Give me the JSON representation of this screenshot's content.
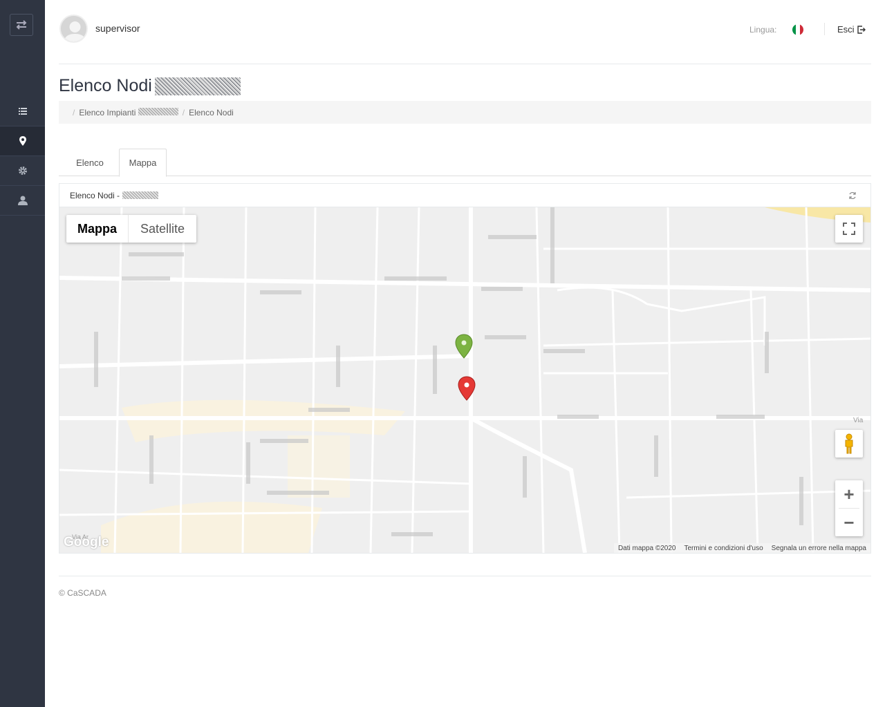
{
  "header": {
    "username": "supervisor",
    "language_label": "Lingua:",
    "logout_label": "Esci"
  },
  "page": {
    "title": "Elenco Nodi",
    "breadcrumb": {
      "item1": "Elenco Impianti",
      "item2": "Elenco Nodi"
    }
  },
  "tabs": [
    {
      "label": "Elenco",
      "active": false
    },
    {
      "label": "Mappa",
      "active": true
    }
  ],
  "panel": {
    "title": "Elenco Nodi -"
  },
  "map": {
    "type_buttons": {
      "map": "Mappa",
      "satellite": "Satellite"
    },
    "selected_type": "Mappa",
    "logo": "Google",
    "attribution": {
      "data": "Dati mappa ©2020",
      "terms": "Termini e condizioni d'uso",
      "report": "Segnala un errore nella mappa"
    },
    "markers": [
      {
        "color": "#7cb342",
        "name": "green-marker"
      },
      {
        "color": "#e53935",
        "name": "red-marker"
      }
    ],
    "street_labels": {
      "label1": "Via",
      "label2": "Via Ar"
    }
  },
  "footer": {
    "copyright": "© CaSCADA"
  },
  "colors": {
    "sidebar": "#2f3542",
    "accent_flag": [
      "#009246",
      "#ffffff",
      "#ce2b37"
    ]
  }
}
